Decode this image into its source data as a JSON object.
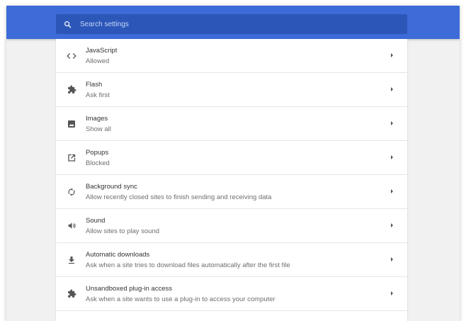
{
  "search": {
    "placeholder": "Search settings",
    "icon": "search-icon"
  },
  "settings": [
    {
      "name": "javascript",
      "icon": "code-brackets-icon",
      "title": "JavaScript",
      "subtitle": "Allowed"
    },
    {
      "name": "flash",
      "icon": "puzzle-piece-icon",
      "title": "Flash",
      "subtitle": "Ask first"
    },
    {
      "name": "images",
      "icon": "image-icon",
      "title": "Images",
      "subtitle": "Show all"
    },
    {
      "name": "popups",
      "icon": "open-in-new-icon",
      "title": "Popups",
      "subtitle": "Blocked"
    },
    {
      "name": "background-sync",
      "icon": "sync-icon",
      "title": "Background sync",
      "subtitle": "Allow recently closed sites to finish sending and receiving data"
    },
    {
      "name": "sound",
      "icon": "speaker-icon",
      "title": "Sound",
      "subtitle": "Allow sites to play sound"
    },
    {
      "name": "automatic-downloads",
      "icon": "download-icon",
      "title": "Automatic downloads",
      "subtitle": "Ask when a site tries to download files automatically after the first file"
    },
    {
      "name": "unsandboxed-plugin-access",
      "icon": "puzzle-piece-icon",
      "title": "Unsandboxed plug-in access",
      "subtitle": "Ask when a site wants to use a plug-in to access your computer"
    }
  ],
  "colors": {
    "header": "#3d6bd8",
    "search_bg": "#2c57b9",
    "background": "#f1f1f1"
  }
}
